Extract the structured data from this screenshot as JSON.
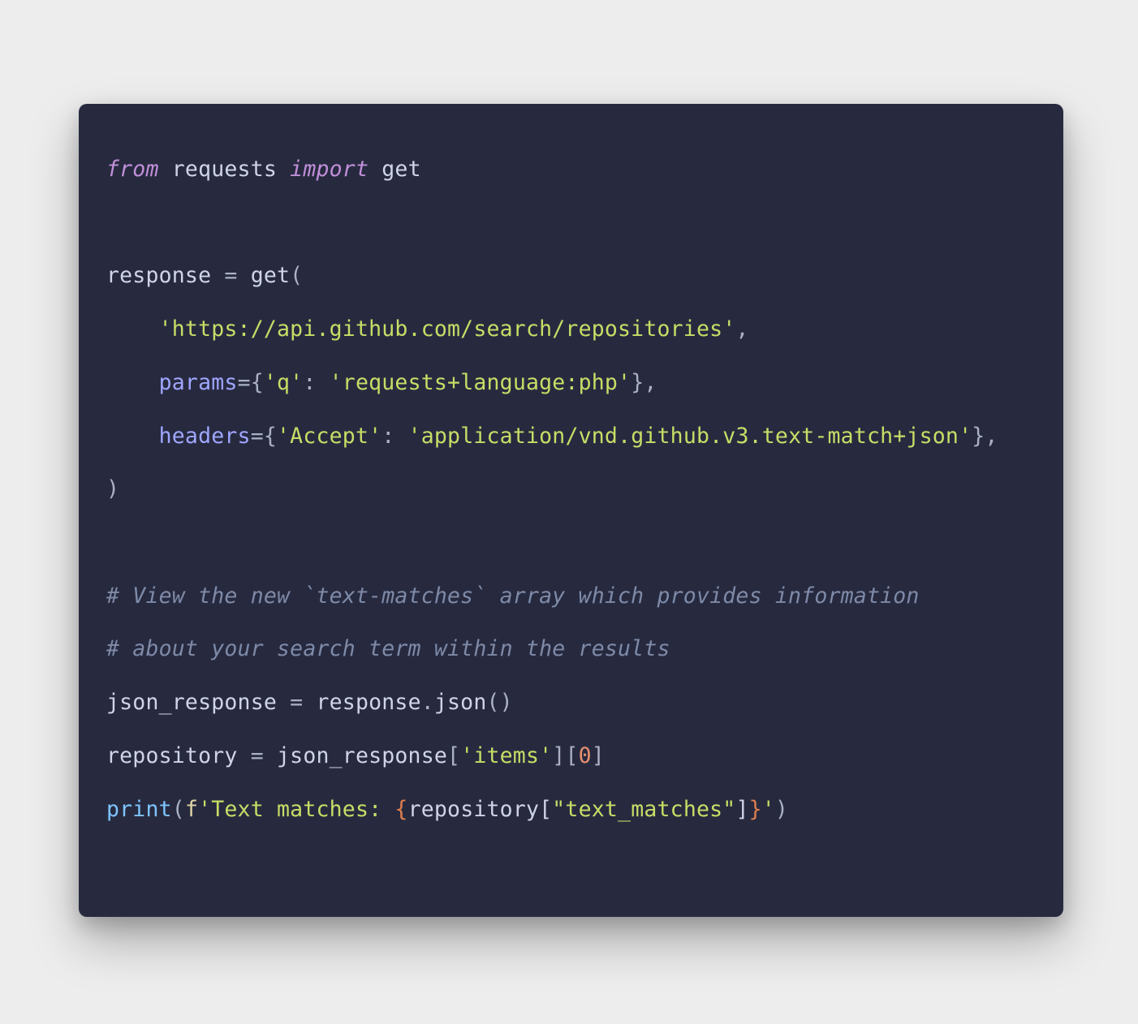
{
  "code": {
    "l1": {
      "from": "from",
      "mod": " requests ",
      "import": "import",
      "name": " get"
    },
    "l2": "",
    "l3": {
      "a": "response ",
      "eq": "=",
      "b": " get",
      "c": "("
    },
    "l4": {
      "pad": "    ",
      "s": "'https://api.github.com/search/repositories'",
      "c": ","
    },
    "l5": {
      "pad": "    ",
      "k": "params",
      "eq": "=",
      "lb": "{",
      "key": "'q'",
      "colon": ": ",
      "val": "'requests+language:php'",
      "rb": "}",
      "c": ","
    },
    "l6": {
      "pad": "    ",
      "k": "headers",
      "eq": "=",
      "lb": "{",
      "key": "'Accept'",
      "colon": ": ",
      "val": "'application/vnd.github.v3.text-match+json'",
      "rb": "}",
      "c": ","
    },
    "l7": {
      "a": ")"
    },
    "l8": "",
    "l9": "# View the new `text-matches` array which provides information",
    "l10": "# about your search term within the results",
    "l11": {
      "a": "json_response ",
      "eq": "=",
      "b": " response",
      "dot": ".",
      "m": "json",
      "p": "()"
    },
    "l12": {
      "a": "repository ",
      "eq": "=",
      "b": " json_response",
      "lb1": "[",
      "k": "'items'",
      "rb1": "]",
      "lb2": "[",
      "n": "0",
      "rb2": "]"
    },
    "l13": {
      "print": "print",
      "lp": "(",
      "f": "f",
      "q1": "'",
      "s1": "Text matches: ",
      "lb": "{",
      "expr_a": "repository",
      "eb1": "[",
      "ek": "\"text_matches\"",
      "eb2": "]",
      "rb": "}",
      "q2": "'",
      "rp": ")"
    }
  }
}
